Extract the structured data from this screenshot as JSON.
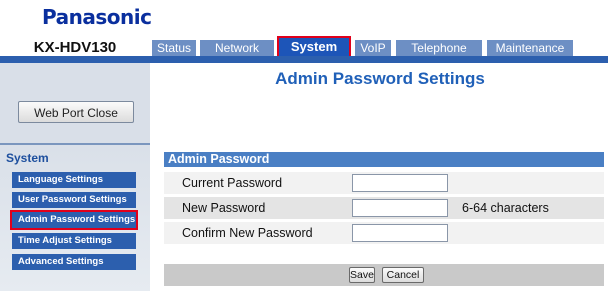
{
  "brand": {
    "logo": "Panasonic",
    "model": "KX-HDV130"
  },
  "tabs": [
    {
      "label": "Status"
    },
    {
      "label": "Network"
    },
    {
      "label": "System",
      "active": true
    },
    {
      "label": "VoIP"
    },
    {
      "label": "Telephone"
    },
    {
      "label": "Maintenance"
    }
  ],
  "sidebar": {
    "web_port_close_label": "Web Port Close",
    "section_title": "System",
    "items": [
      {
        "label": "Language Settings"
      },
      {
        "label": "User Password Settings"
      },
      {
        "label": "Admin Password Settings",
        "active": true
      },
      {
        "label": "Time Adjust Settings"
      },
      {
        "label": "Advanced Settings"
      }
    ]
  },
  "main": {
    "title": "Admin Password Settings",
    "section_header": "Admin Password",
    "fields": [
      {
        "label": "Current Password",
        "value": "",
        "hint": ""
      },
      {
        "label": "New Password",
        "value": "",
        "hint": "6-64 characters"
      },
      {
        "label": "Confirm New Password",
        "value": "",
        "hint": ""
      }
    ],
    "save_label": "Save",
    "cancel_label": "Cancel"
  },
  "colors": {
    "brand_blue": "#0a2f9e",
    "nav_blue": "#2c5fae",
    "active_tab": "#1d55b8",
    "highlight_red": "#e0001b"
  }
}
